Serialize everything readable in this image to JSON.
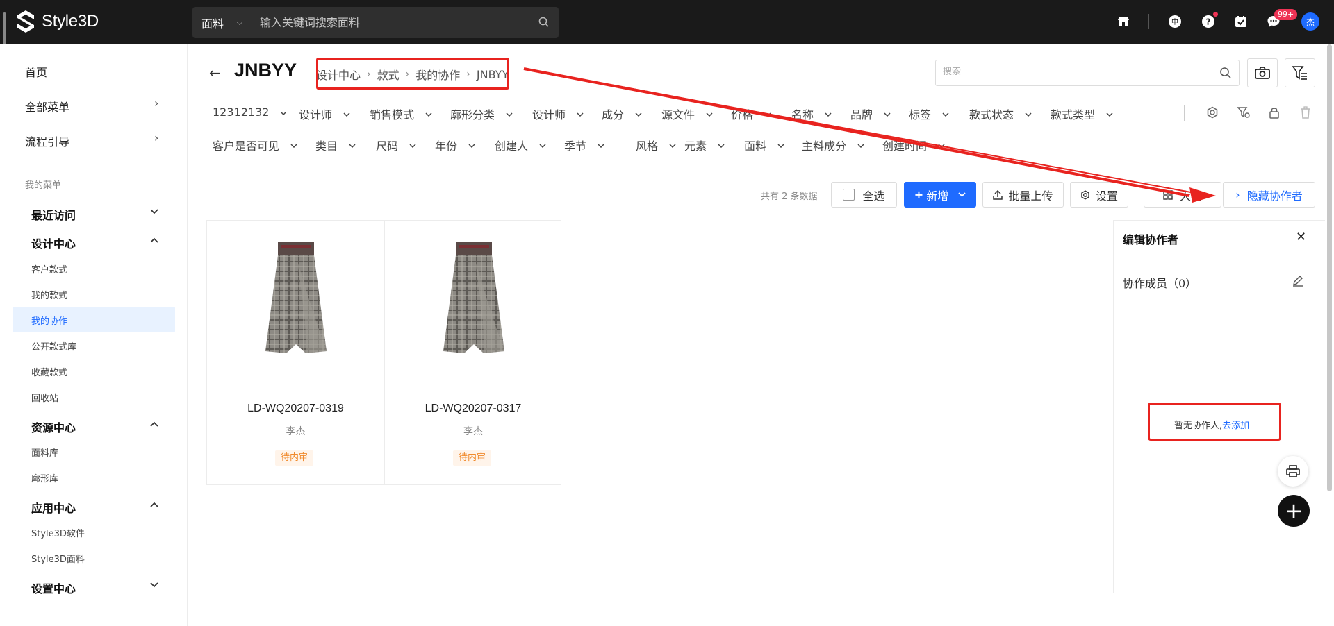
{
  "app": {
    "brand": "Style3D",
    "search": {
      "category": "面料",
      "placeholder": "输入关键词搜索面料"
    },
    "notification_badge": "99+",
    "avatar": "杰"
  },
  "sidebar": {
    "top_items": [
      {
        "label": "首页"
      },
      {
        "label": "全部菜单"
      },
      {
        "label": "流程引导"
      }
    ],
    "caption": "我的菜单",
    "groups": [
      {
        "label": "最近访问",
        "expanded": false,
        "items": []
      },
      {
        "label": "设计中心",
        "expanded": true,
        "items": [
          "客户款式",
          "我的款式",
          "我的协作",
          "公开款式库",
          "收藏款式",
          "回收站"
        ]
      },
      {
        "label": "资源中心",
        "expanded": true,
        "items": [
          "面料库",
          "廓形库"
        ]
      },
      {
        "label": "应用中心",
        "expanded": true,
        "items": [
          "Style3D软件",
          "Style3D面料"
        ]
      },
      {
        "label": "设置中心",
        "expanded": false,
        "items": []
      }
    ],
    "active_item": "我的协作"
  },
  "header": {
    "title": "JNBYY",
    "breadcrumb": [
      "设计中心",
      "款式",
      "我的协作",
      "JNBYY"
    ],
    "search_placeholder": "搜索"
  },
  "filters": {
    "row1": [
      "12312132",
      "设计师",
      "销售模式",
      "廓形分类",
      "设计师",
      "成分",
      "源文件",
      "价格",
      "名称",
      "品牌",
      "标签",
      "款式状态",
      "款式类型"
    ],
    "row2": [
      "客户是否可见",
      "类目",
      "尺码",
      "年份",
      "创建人",
      "季节",
      "风格",
      "元素",
      "面料",
      "主料成分",
      "创建时间"
    ]
  },
  "toolbar": {
    "total": "共有 2 条数据",
    "select_all": "全选",
    "add": "新增",
    "bulk_upload": "批量上传",
    "settings": "设置",
    "view_mode": "大图",
    "hide_collaborators": "隐藏协作者"
  },
  "cards": [
    {
      "code": "LD-WQ20207-0319",
      "author": "李杰",
      "status": "待内审"
    },
    {
      "code": "LD-WQ20207-0317",
      "author": "李杰",
      "status": "待内审"
    }
  ],
  "panel": {
    "title": "编辑协作者",
    "members_label": "协作成员（0）",
    "empty_text": "暂无协作人,",
    "empty_link": "去添加"
  },
  "colors": {
    "topbar": "#1a1a1a",
    "primary": "#1f6bff",
    "annotation_red": "#e8231f",
    "status_orange": "#f08a2c"
  }
}
